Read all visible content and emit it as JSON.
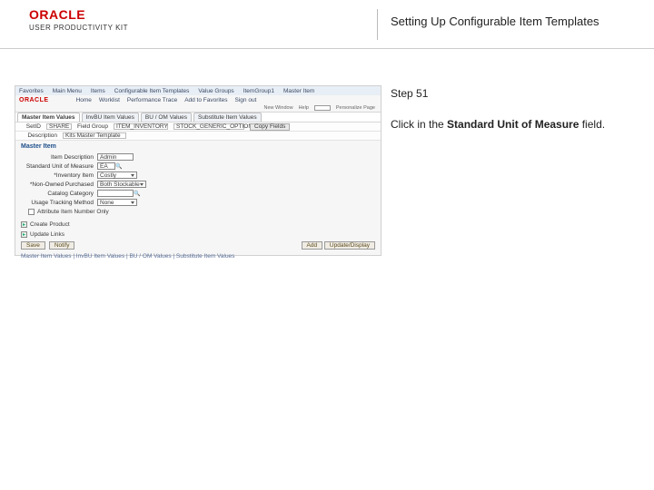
{
  "header": {
    "logo_text": "ORACLE",
    "logo_subtitle": "USER PRODUCTIVITY KIT",
    "page_title": "Setting Up Configurable Item Templates"
  },
  "instructions": {
    "step_label": "Step 51",
    "body_prefix": "Click in the ",
    "body_bold": "Standard Unit of Measure",
    "body_suffix": " field."
  },
  "app": {
    "top_menu": [
      "Favorites",
      "Main Menu",
      "Items",
      "Configurable Item Templates",
      "Value Groups",
      "ItemGroup1",
      "Master Item"
    ],
    "brand": "ORACLE",
    "nav": [
      "Home",
      "Worklist",
      "Performance Trace",
      "Add to Favorites",
      "Sign out"
    ],
    "pagebar": {
      "new_window": "New Window",
      "help": "Help",
      "personalize": "Personalize Page"
    },
    "tabs": [
      "Master Item Values",
      "InvBU Item Values",
      "BU / OM Values",
      "Substitute Item Values"
    ],
    "seg": {
      "setid_label": "SetID",
      "setid_value": "SHARE",
      "fg_label": "Field Group",
      "fg_value": "ITEM_INVENTORY",
      "fg_desc_value": "STOCK_GENERIC_OPTIONS",
      "copy_btn": "Copy Fields",
      "desc_label": "Description",
      "desc_value": "Kits Master Template"
    },
    "section": "Master Item",
    "form": {
      "f1": {
        "label": "Item Description",
        "value": "Admin"
      },
      "f2": {
        "label": "Standard Unit of Measure",
        "value": "EA"
      },
      "f3": {
        "label": "*Inventory Item",
        "value": "Costly"
      },
      "f4": {
        "label": "*Non-Owned Purchased",
        "value": "Both Stockable"
      },
      "f5": {
        "label": "Catalog Category"
      },
      "f6": {
        "label": "Usage Tracking Method",
        "value": "None"
      },
      "f7": {
        "label": "Attribute Item Number Only"
      }
    },
    "create_product": "Create Product",
    "update_links": "Update Links",
    "buttons": {
      "save": "Save",
      "notify": "Notify",
      "add": "Add",
      "update": "Update/Display"
    },
    "footer": "Master Item Values | InvBU Item Values | BU / OM Values | Substitute Item Values"
  }
}
